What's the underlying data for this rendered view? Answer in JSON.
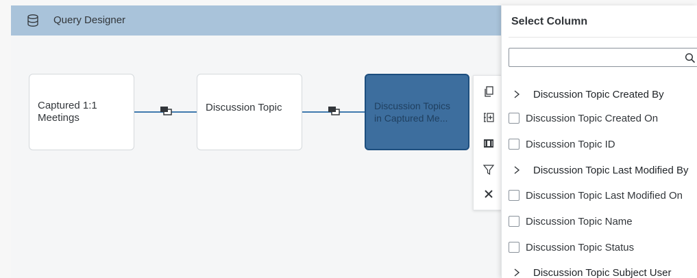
{
  "header": {
    "title": "Query Designer",
    "icon": "database-icon"
  },
  "nodes": [
    {
      "label": "Captured 1:1 Meetings",
      "selected": false
    },
    {
      "label": "Discussion Topic",
      "selected": false
    },
    {
      "label": "Discussion Topics in Captured Me...",
      "selected": true
    }
  ],
  "toolbar": {
    "items": [
      "copy-icon",
      "add-column-icon",
      "columns-icon",
      "filter-icon",
      "close-icon"
    ]
  },
  "panel": {
    "title": "Select Column",
    "search": {
      "value": "",
      "placeholder": ""
    },
    "items": [
      {
        "label": "Discussion Topic Created By",
        "type": "expandable"
      },
      {
        "label": "Discussion Topic Created On",
        "type": "checkbox",
        "checked": false
      },
      {
        "label": "Discussion Topic ID",
        "type": "checkbox",
        "checked": false
      },
      {
        "label": "Discussion Topic Last Modified By",
        "type": "expandable"
      },
      {
        "label": "Discussion Topic Last Modified On",
        "type": "checkbox",
        "checked": false
      },
      {
        "label": "Discussion Topic Name",
        "type": "checkbox",
        "checked": false
      },
      {
        "label": "Discussion Topic Status",
        "type": "checkbox",
        "checked": false
      },
      {
        "label": "Discussion Topic Subject User",
        "type": "expandable"
      }
    ]
  },
  "colors": {
    "header_bg": "#a9c3da",
    "selected_node_bg": "#3d6e9e",
    "connector": "#3f79ad"
  }
}
